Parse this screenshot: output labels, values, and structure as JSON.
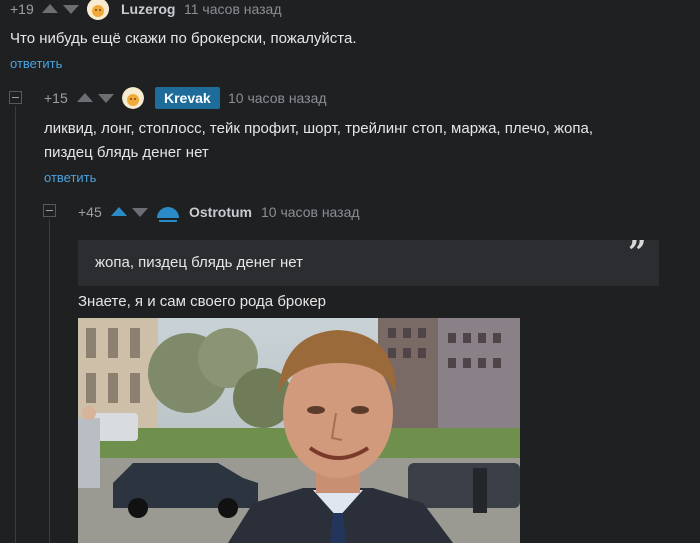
{
  "comments": [
    {
      "rating": "+19",
      "author": "Luzerog",
      "time": "11 часов назад",
      "text": "Что нибудь ещё скажи по брокерски, пожалуйста.",
      "reply": "ответить"
    },
    {
      "rating": "+15",
      "author": "Krevak",
      "time": "10 часов назад",
      "text_line1": "ликвид, лонг, стоплосс, тейк профит, шорт, трейлинг стоп, маржа, плечо, жопа,",
      "text_line2": "пиздец блядь денег нет",
      "reply": "ответить"
    },
    {
      "rating": "+45",
      "author": "Ostrotum",
      "time": "10 часов назад",
      "quote": "жопа, пиздец блядь денег нет",
      "quote_mark": "”",
      "text": "Знаете, я и сам своего рода брокер"
    }
  ],
  "colors": {
    "background": "#1f2022",
    "link": "#4aa3df",
    "op_badge": "#1d6c9a",
    "upvote_active": "#2b8ac8"
  }
}
